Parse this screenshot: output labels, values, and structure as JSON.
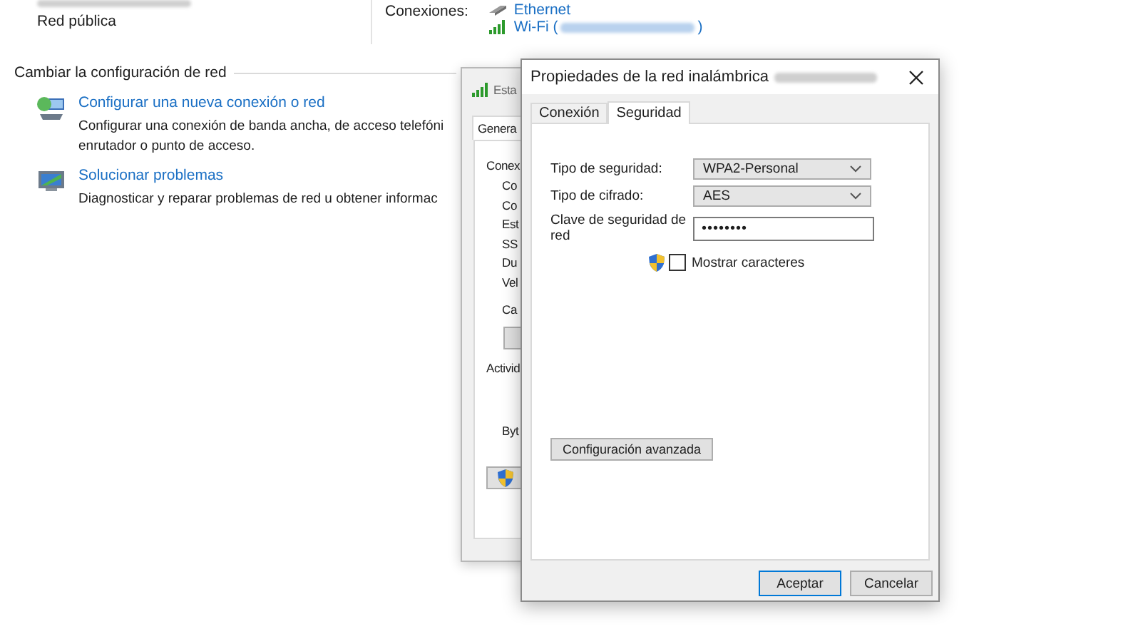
{
  "network_panel": {
    "network_type": "Red pública",
    "connections_label": "Conexiones:",
    "connections": [
      {
        "kind": "ethernet",
        "label": "Ethernet"
      },
      {
        "kind": "wifi",
        "label": "Wi-Fi (",
        "suffix": ")"
      }
    ]
  },
  "change_settings": {
    "heading": "Cambiar la configuración de red",
    "tasks": [
      {
        "kind": "new-connection",
        "link": "Configurar una nueva conexión o red",
        "description": [
          "Configurar una conexión de banda ancha, de acceso telefóni",
          "enrutador o punto de acceso."
        ]
      },
      {
        "kind": "troubleshoot",
        "link": "Solucionar problemas",
        "description": [
          "Diagnosticar y reparar problemas de red u obtener informac"
        ]
      }
    ]
  },
  "status_dialog": {
    "title": "Esta",
    "tab": "Genera",
    "items": [
      {
        "kind": "section",
        "text": "Conex"
      },
      {
        "kind": "field",
        "text": "Co"
      },
      {
        "kind": "field",
        "text": "Co"
      },
      {
        "kind": "field",
        "text": "Est"
      },
      {
        "kind": "field",
        "text": "SS"
      },
      {
        "kind": "field",
        "text": "Du"
      },
      {
        "kind": "field",
        "text": "Vel"
      },
      {
        "kind": "spaced-field",
        "text": "Ca"
      },
      {
        "kind": "button"
      },
      {
        "kind": "section",
        "text": "Activid"
      },
      {
        "kind": "low-field",
        "text": "Byt"
      },
      {
        "kind": "shield-button"
      }
    ]
  },
  "properties_dialog": {
    "title": "Propiedades de la red inalámbrica",
    "tabs": [
      {
        "label": "Conexión",
        "selected": false
      },
      {
        "label": "Seguridad",
        "selected": true
      }
    ],
    "fields": [
      {
        "kind": "select",
        "label": "Tipo de seguridad:",
        "value": "WPA2-Personal"
      },
      {
        "kind": "select",
        "label": "Tipo de cifrado:",
        "value": "AES"
      },
      {
        "kind": "password",
        "label": "Clave de seguridad de red",
        "value": "••••••••"
      }
    ],
    "show_characters": {
      "label": "Mostrar caracteres",
      "checked": false
    },
    "advanced_button": "Configuración avanzada",
    "buttons": [
      {
        "label": "Aceptar",
        "default": true
      },
      {
        "label": "Cancelar",
        "default": false
      }
    ]
  }
}
